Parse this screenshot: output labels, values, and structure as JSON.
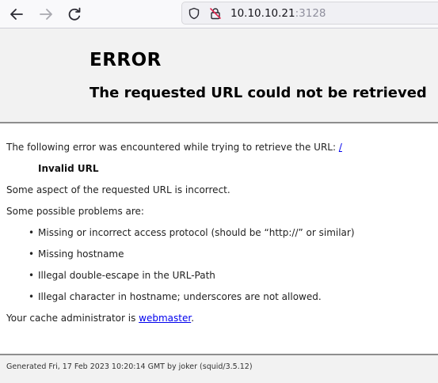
{
  "browser": {
    "url_host": "10.10.10.21",
    "url_port": ":3128"
  },
  "page": {
    "heading": "ERROR",
    "title": "The requested URL could not be retrieved",
    "intro": "The following error was encountered while trying to retrieve the URL: ",
    "intro_link": "/",
    "error_name": "Invalid URL",
    "description": "Some aspect of the requested URL is incorrect.",
    "problems_heading": "Some possible problems are:",
    "problems": [
      "Missing or incorrect access protocol (should be “http://” or similar)",
      "Missing hostname",
      "Illegal double-escape in the URL-Path",
      "Illegal character in hostname; underscores are not allowed."
    ],
    "admin_prefix": "Your cache administrator is ",
    "admin_link": "webmaster",
    "admin_suffix": ".",
    "footer": "Generated Fri, 17 Feb 2023 10:20:14 GMT by joker (squid/3.5.12)"
  }
}
